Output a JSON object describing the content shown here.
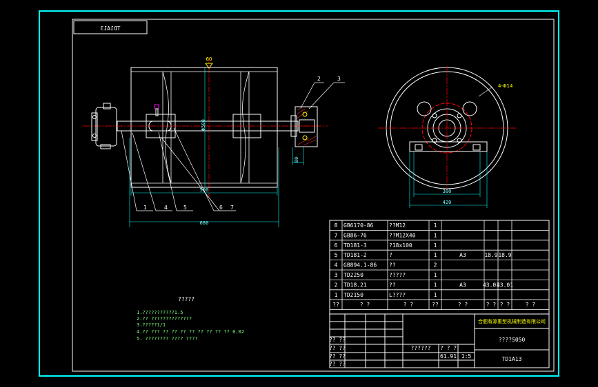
{
  "title_mirrored": "TD1A13",
  "callouts": {
    "top_right": [
      "2",
      "3"
    ],
    "bottom_left": [
      "1",
      "4",
      "5",
      "6",
      "7"
    ]
  },
  "dimensions": {
    "overall_length": "680",
    "drum_length": "500",
    "drum_dia": "Φ500",
    "hub_width": "80",
    "holes": "4-Φ14",
    "base_inner": "380",
    "base_outer": "420",
    "top_mark": "60"
  },
  "notes": {
    "title": "?????",
    "lines": [
      "1.???????????1.5",
      "2.?? ??????????????",
      "3.?????1/1",
      "4.?? ???  ??  ??  ??  ??  ??  ??  ??  ?? 0.02",
      "5. ????????  ???? ????"
    ]
  },
  "bom": {
    "rows": [
      {
        "no": "8",
        "code": "GB6170-86",
        "name": "??M12",
        "qty": "1",
        "mat": "",
        "w1": "",
        "w2": ""
      },
      {
        "no": "7",
        "code": "GB86-76",
        "name": "??M12X40",
        "qty": "1",
        "mat": "",
        "w1": "",
        "w2": ""
      },
      {
        "no": "6",
        "code": "TD181-3",
        "name": "?18x100",
        "qty": "1",
        "mat": "",
        "w1": "",
        "w2": ""
      },
      {
        "no": "5",
        "code": "TD181-2",
        "name": "?",
        "qty": "1",
        "mat": "A3",
        "w1": "18.9",
        "w2": "18.9"
      },
      {
        "no": "4",
        "code": "GB894.1-86",
        "name": "??",
        "qty": "2",
        "mat": "",
        "w1": "",
        "w2": ""
      },
      {
        "no": "3",
        "code": "TD2250",
        "name": "?????",
        "qty": "1",
        "mat": "",
        "w1": "",
        "w2": ""
      },
      {
        "no": "2",
        "code": "TD18.21",
        "name": "??",
        "qty": "1",
        "mat": "A3",
        "w1": "43.01",
        "w2": "43.01"
      },
      {
        "no": "1",
        "code": "TD2150",
        "name": "L????",
        "qty": "1",
        "mat": "",
        "w1": "",
        "w2": ""
      }
    ],
    "header": [
      "??",
      "?  ?",
      "?  ?",
      "??",
      "?  ?",
      "?  ?",
      "?  ?",
      "?  ?"
    ]
  },
  "title_block": {
    "company": "合肥有源重型机械制造有限公司",
    "drawing_name": "????S050",
    "drawing_code": "TD1A13",
    "scale": "1:5",
    "weight": "61.91",
    "small_rows": [
      "?? ??",
      "?? ??",
      "?? ??",
      "?? ??"
    ],
    "stage_label": "??????",
    "weight_label": "? ? ?"
  },
  "colors": {
    "border": "#00ffff",
    "line": "#ffffff",
    "center": "#ff0000",
    "dim": "#00ffff",
    "hatch": "#ff3030",
    "note": "#7dff7d"
  }
}
